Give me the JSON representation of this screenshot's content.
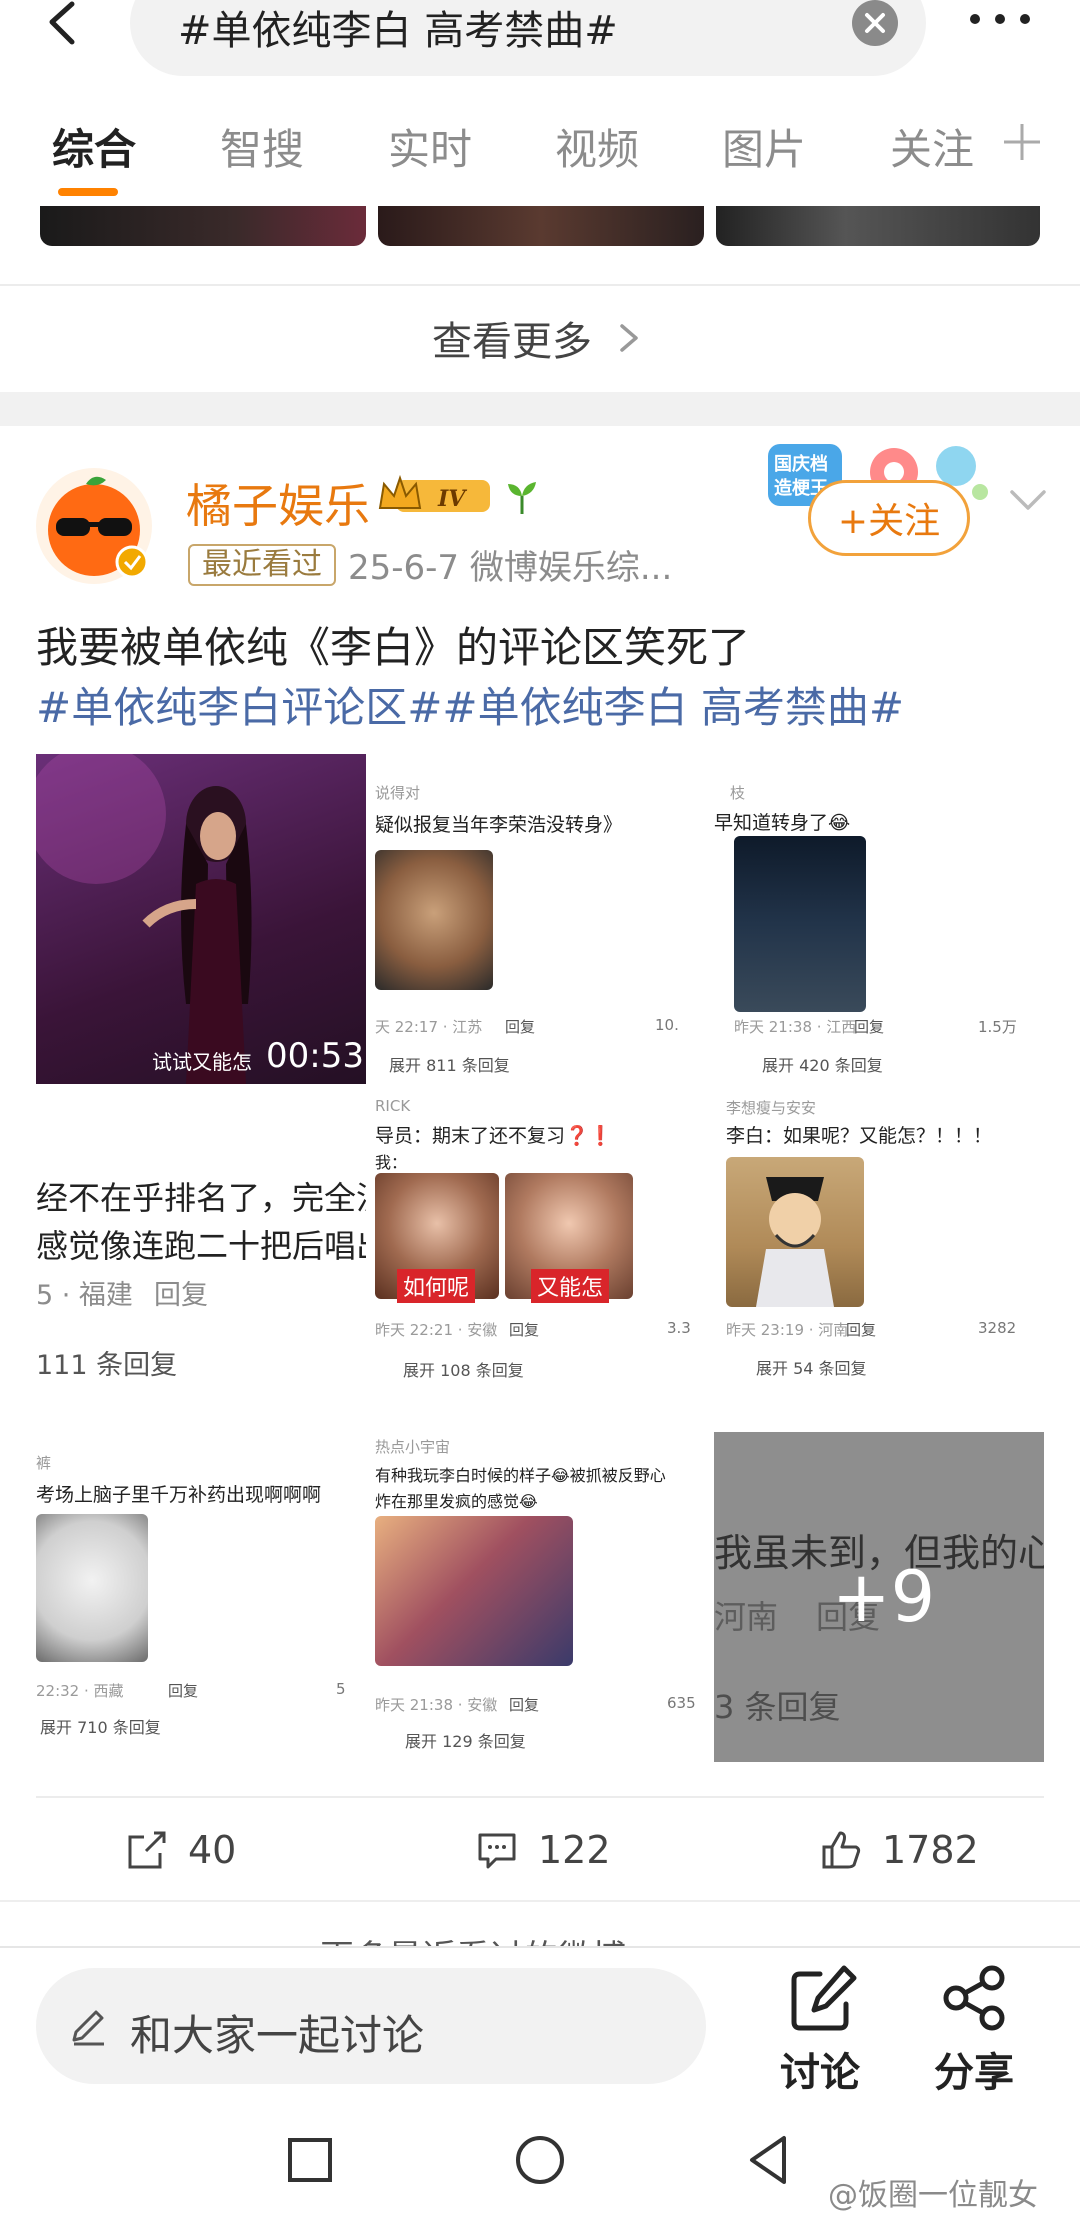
{
  "search": {
    "query": "#单依纯李白 高考禁曲#"
  },
  "tabs": [
    {
      "label": "综合"
    },
    {
      "label": "智搜"
    },
    {
      "label": "实时"
    },
    {
      "label": "视频"
    },
    {
      "label": "图片"
    },
    {
      "label": "关注"
    }
  ],
  "see_more": {
    "label": "查看更多"
  },
  "post": {
    "author": "橘子娱乐",
    "level": "IV",
    "recent_tag": "最近看过",
    "meta": "25-6-7  微博娱乐综...",
    "follow_label": "+关注",
    "text": "我要被单依纯《李白》的评论区笑死了",
    "hashtags": "#单依纯李白评论区##单依纯李白 高考禁曲#",
    "event_badge": "国庆档 造梗王",
    "grid": {
      "video": {
        "caption": "试试又能怎",
        "duration": "00:53"
      },
      "c2": {
        "user": "说得对",
        "text": "疑似报复当年李荣浩没转身》",
        "meta": "天 22:17 · 江苏",
        "reply": "回复",
        "likes": "10.",
        "expand": "展开 811 条回复"
      },
      "c3": {
        "user": "枝",
        "text": "早知道转身了😂",
        "meta": "昨天 21:38 · 江西",
        "reply": "回复",
        "likes": "1.5万",
        "expand": "展开 420 条回复"
      },
      "c4": {
        "line1": "经不在乎排名了，完全沉",
        "line2": "感觉像连跑二十把后唱出",
        "meta": "5 · 福建",
        "reply": "回复",
        "expand": "111 条回复"
      },
      "c5": {
        "user": "RICK",
        "text": "导员：期末了还不复习❓❗",
        "text2": "我：",
        "label1": "如何呢",
        "label2": "又能怎",
        "meta": "昨天 22:21 · 安徽",
        "reply": "回复",
        "likes": "3.3",
        "expand": "展开 108 条回复"
      },
      "c6": {
        "user": "李想瘦与安安",
        "text": "李白：如果呢？又能怎？！！！",
        "meta": "昨天 23:19 · 河南",
        "reply": "回复",
        "likes": "3282",
        "expand": "展开 54 条回复"
      },
      "c7": {
        "user": "裤",
        "text": "考场上脑子里千万补药出现啊啊啊",
        "meta": "22:32 · 西藏",
        "reply": "回复",
        "likes": "5",
        "expand": "展开 710 条回复"
      },
      "c8": {
        "user": "热点小宇宙",
        "text": "有种我玩李白时候的样子😂被抓被反野心",
        "text2": "炸在那里发疯的感觉😂",
        "meta": "昨天 21:38 · 安徽",
        "reply": "回复",
        "likes": "635",
        "expand": "展开 129 条回复"
      },
      "c9": {
        "bg_text": "我虽未到，但我的心",
        "bg_meta": "河南",
        "bg_reply": "回复",
        "bg_expand": "3 条回复",
        "more_count": "+9"
      }
    },
    "reposts": "40",
    "comments": "122",
    "likes": "1782"
  },
  "next_peek": "更多最近看过的微博",
  "bottom_bar": {
    "placeholder": "和大家一起讨论",
    "discuss_label": "讨论",
    "share_label": "分享"
  },
  "watermark": "@饭圈一位靓女",
  "colors": {
    "accent": "#ff8200",
    "author": "#e8790f",
    "hashtag": "#4a6aa6"
  }
}
